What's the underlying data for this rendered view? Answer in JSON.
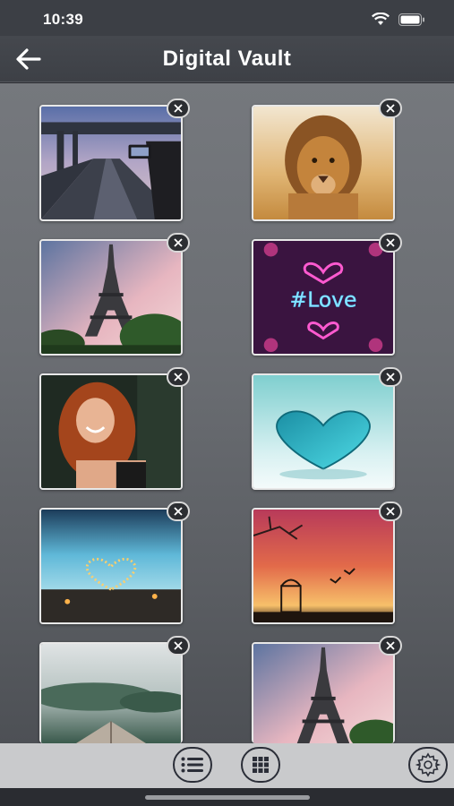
{
  "status": {
    "time": "10:39"
  },
  "nav": {
    "title": "Digital Vault",
    "back_icon": "arrow-left-icon"
  },
  "photos": [
    {
      "subject": "road-bridge-photo"
    },
    {
      "subject": "lion-photo"
    },
    {
      "subject": "eiffel-tower-photo"
    },
    {
      "subject": "love-neon-photo"
    },
    {
      "subject": "woman-red-hair-photo"
    },
    {
      "subject": "glass-heart-photo"
    },
    {
      "subject": "heart-lights-photo"
    },
    {
      "subject": "sunset-birdcage-photo"
    },
    {
      "subject": "book-landscape-photo"
    },
    {
      "subject": "eiffel-tower-photo-2"
    }
  ],
  "toolbar": {
    "list_icon": "list-icon",
    "grid_icon": "grid-icon",
    "settings_icon": "gear-icon"
  },
  "colors": {
    "nav_bg": "#3d4046",
    "content_bg": "#6b6e73",
    "toolbar_bg": "#c9cacc"
  }
}
